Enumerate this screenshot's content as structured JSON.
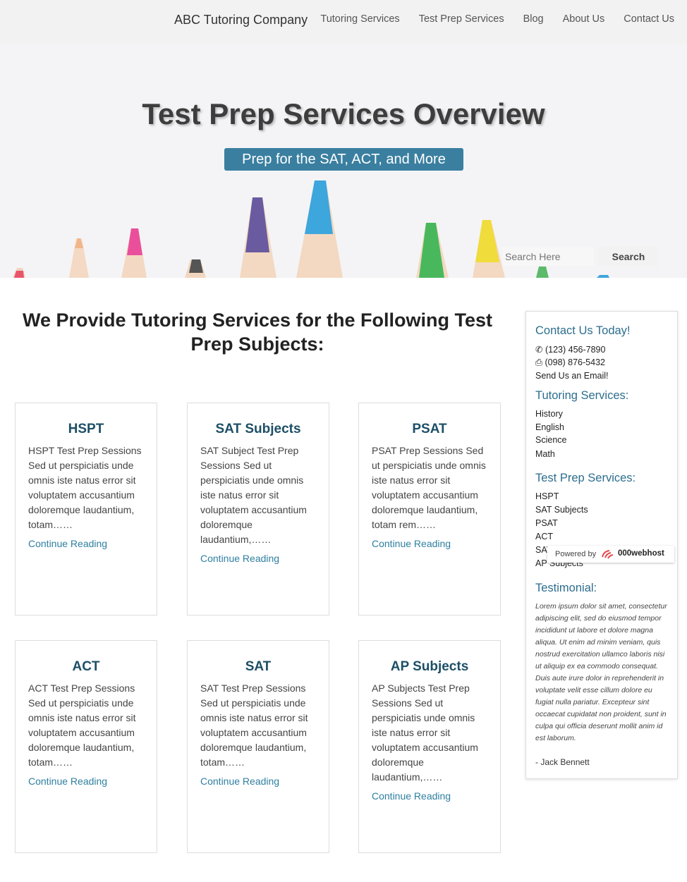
{
  "nav": {
    "brand": "ABC Tutoring Company",
    "links": [
      "Tutoring Services",
      "Test Prep Services",
      "Blog",
      "About Us",
      "Contact Us"
    ]
  },
  "hero": {
    "title": "Test Prep Services Overview",
    "subtitle": "Prep for the SAT, ACT, and More",
    "search_placeholder": "Search Here",
    "search_button": "Search"
  },
  "main": {
    "heading": "We Provide Tutoring Services for the Following Test Prep Subjects:",
    "cards": [
      {
        "title": "HSPT",
        "text": "HSPT Test Prep Sessions Sed ut perspiciatis unde omnis iste natus error sit voluptatem accusantium doloremque laudantium, totam……",
        "link": "Continue Reading"
      },
      {
        "title": "SAT Subjects",
        "text": "SAT Subject Test Prep Sessions Sed ut perspiciatis unde omnis iste natus error sit voluptatem accusantium doloremque laudantium,……",
        "link": "Continue Reading"
      },
      {
        "title": "PSAT",
        "text": "PSAT Prep Sessions Sed ut perspiciatis unde omnis iste natus error sit voluptatem accusantium doloremque laudantium, totam rem……",
        "link": "Continue Reading"
      },
      {
        "title": "ACT",
        "text": "ACT Test Prep Sessions Sed ut perspiciatis unde omnis iste natus error sit voluptatem accusantium doloremque laudantium, totam……",
        "link": "Continue Reading"
      },
      {
        "title": "SAT",
        "text": "SAT Test Prep Sessions Sed ut perspiciatis unde omnis iste natus error sit voluptatem accusantium doloremque laudantium, totam……",
        "link": "Continue Reading"
      },
      {
        "title": "AP Subjects",
        "text": "AP Subjects Test Prep Sessions Sed ut perspiciatis unde omnis iste natus error sit voluptatem accusantium doloremque laudantium,……",
        "link": "Continue Reading"
      }
    ]
  },
  "sidebar": {
    "contact_heading": "Contact Us Today!",
    "phone": "(123) 456-7890",
    "fax": "(098) 876-5432",
    "email": "Send Us an Email!",
    "tutoring_heading": "Tutoring Services:",
    "tutoring_items": [
      "History",
      "English",
      "Science",
      "Math"
    ],
    "testprep_heading": "Test Prep Services:",
    "testprep_items": [
      "HSPT",
      "SAT Subjects",
      "PSAT",
      "ACT",
      "SAT",
      "AP Subjects"
    ],
    "testimonial_heading": "Testimonial:",
    "testimonial_text": "Lorem ipsum dolor sit amet, consectetur adipiscing elit, sed do eiusmod tempor incididunt ut labore et dolore magna aliqua. Ut enim ad minim veniam, quis nostrud exercitation ullamco laboris nisi ut aliquip ex ea commodo consequat. Duis aute irure dolor in reprehenderit in voluptate velit esse cillum dolore eu fugiat nulla pariatur. Excepteur sint occaecat cupidatat non proident, sunt in culpa qui officia deserunt mollit anim id est laborum.",
    "testimonial_author": "- Jack Bennett"
  },
  "badge": {
    "label": "Powered by",
    "brand": "000webhost"
  }
}
